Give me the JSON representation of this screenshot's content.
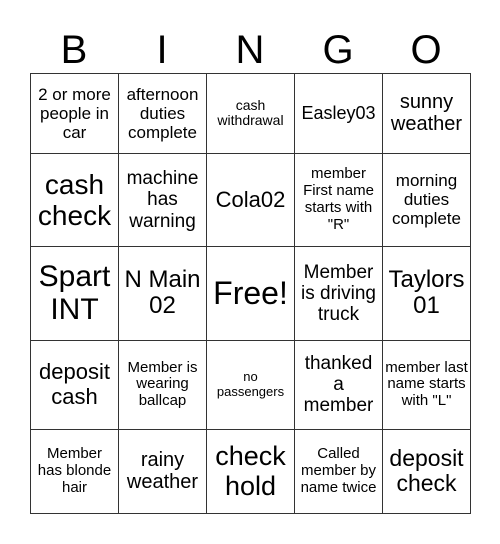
{
  "header": [
    "B",
    "I",
    "N",
    "G",
    "O"
  ],
  "cells": [
    [
      "2 or more people in car",
      "afternoon duties complete",
      "cash withdrawal",
      "Easley03",
      "sunny weather"
    ],
    [
      "cash check",
      "machine has warning",
      "Cola02",
      "member First name starts with \"R\"",
      "morning duties complete"
    ],
    [
      "Spart INT",
      "N Main 02",
      "Free!",
      "Member is driving truck",
      "Taylors 01"
    ],
    [
      "deposit cash",
      "Member is wearing ballcap",
      "no passengers",
      "thanked a member",
      "member last name starts with \"L\""
    ],
    [
      "Member has blonde hair",
      "rainy weather",
      "check hold",
      "Called member by name twice",
      "deposit check"
    ]
  ]
}
